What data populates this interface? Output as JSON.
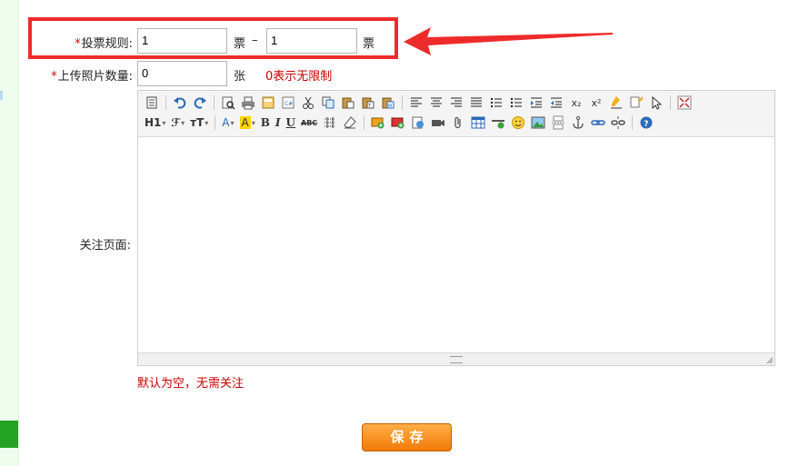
{
  "form": {
    "vote_rule": {
      "required_mark": "*",
      "label": "投票规则:",
      "min_value": "1",
      "min_unit": "票",
      "separator": "–",
      "max_value": "1",
      "max_unit": "票"
    },
    "photo_count": {
      "required_mark": "*",
      "label": "上传照片数量:",
      "value": "0",
      "unit": "张",
      "hint": "0表示无限制"
    },
    "follow_page": {
      "label": "关注页面:",
      "hint": "默认为空，无需关注"
    },
    "save_label": "保存"
  },
  "toolbar": {
    "heading": "H1",
    "font_family": "ℱ",
    "font_size": "тT",
    "font_color": "A",
    "bg_color": "A",
    "bold": "B",
    "italic": "I",
    "underline": "U",
    "strike": "ABC",
    "subscript": "x₂",
    "superscript": "x²"
  },
  "colors": {
    "highlight_border": "#ee2b2b",
    "required": "#d20000",
    "hint": "#c80000",
    "save_button": "#f07b08",
    "left_green": "#22a322"
  }
}
